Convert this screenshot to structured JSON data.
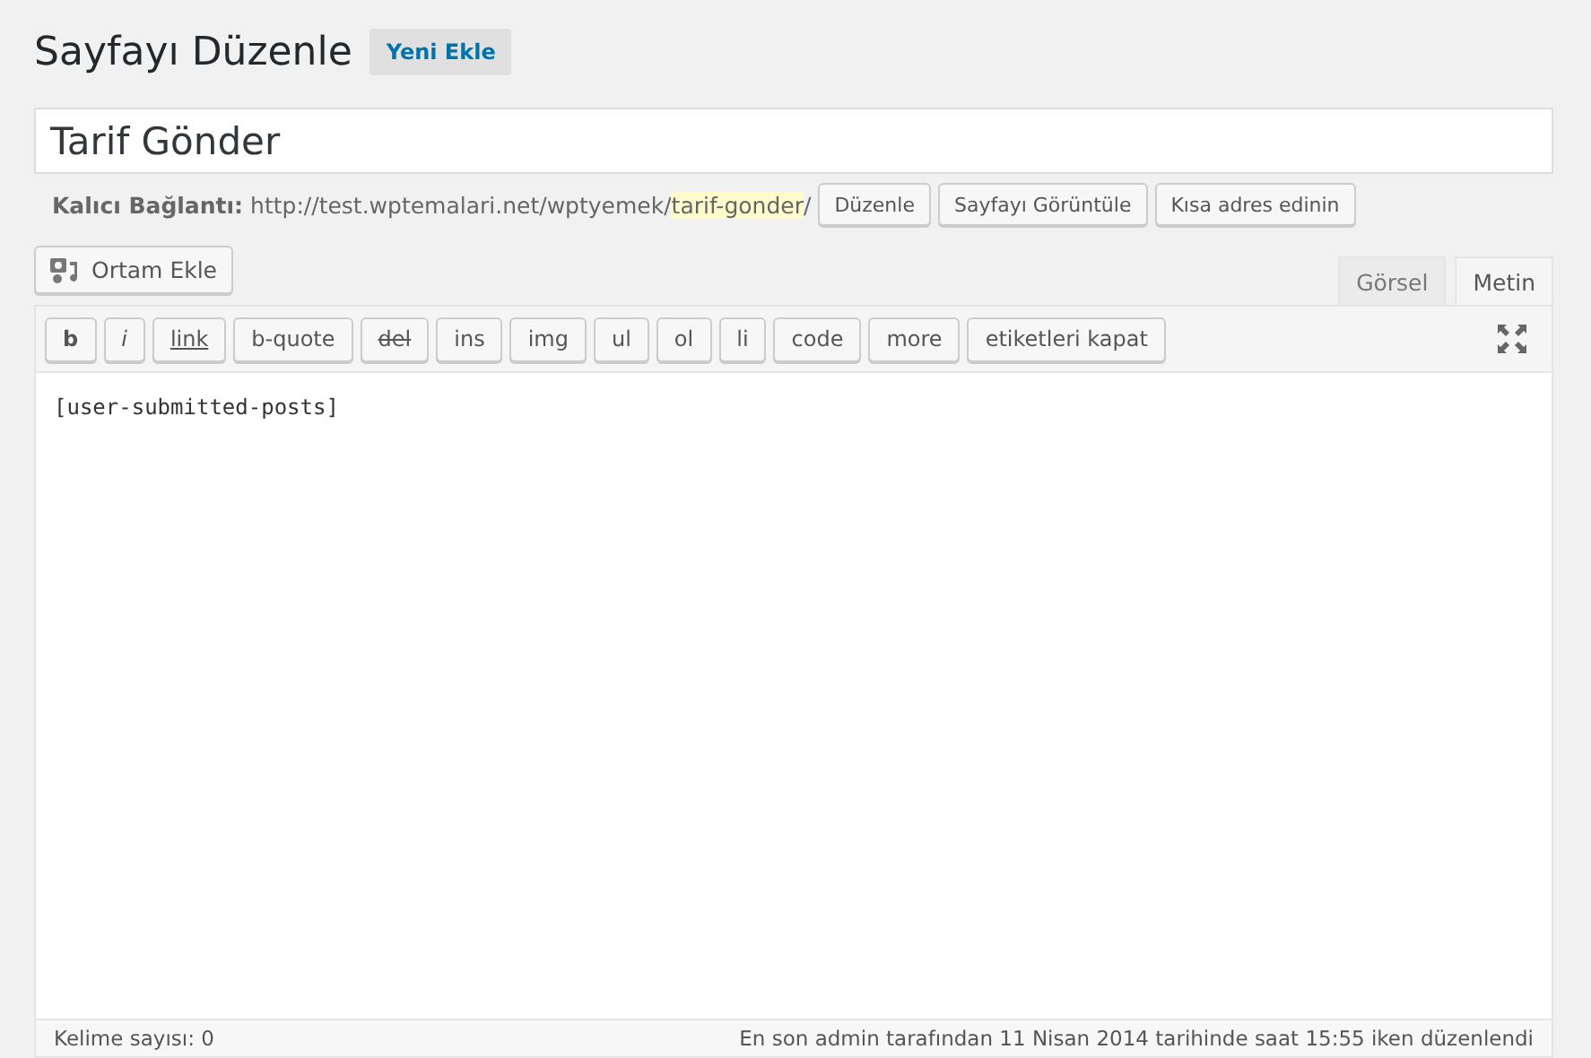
{
  "heading": {
    "title": "Sayfayı Düzenle",
    "add_new": "Yeni Ekle"
  },
  "title_field": {
    "value": "Tarif Gönder"
  },
  "permalink": {
    "label": "Kalıcı Bağlantı:",
    "base": "http://test.wptemalari.net/wptyemek/",
    "slug": "tarif-gonder",
    "trail": "/",
    "buttons": [
      "Düzenle",
      "Sayfayı Görüntüle",
      "Kısa adres edinin"
    ]
  },
  "media_button": "Ortam Ekle",
  "tabs": [
    {
      "label": "Görsel",
      "selected": false
    },
    {
      "label": "Metin",
      "selected": true
    }
  ],
  "quicktags": [
    {
      "label": "b",
      "kind": "bold"
    },
    {
      "label": "i",
      "kind": "italic"
    },
    {
      "label": "link",
      "kind": "underline"
    },
    {
      "label": "b-quote",
      "kind": "plain"
    },
    {
      "label": "del",
      "kind": "strike"
    },
    {
      "label": "ins",
      "kind": "plain"
    },
    {
      "label": "img",
      "kind": "plain"
    },
    {
      "label": "ul",
      "kind": "plain"
    },
    {
      "label": "ol",
      "kind": "plain"
    },
    {
      "label": "li",
      "kind": "plain"
    },
    {
      "label": "code",
      "kind": "plain"
    },
    {
      "label": "more",
      "kind": "plain"
    },
    {
      "label": "etiketleri kapat",
      "kind": "plain"
    }
  ],
  "editor": {
    "value": "[user-submitted-posts]"
  },
  "status_bar": {
    "word_count": "Kelime sayısı: 0",
    "last_edit": "En son admin tarafından 11 Nisan 2014 tarihinde saat 15:55 iken düzenlendi"
  }
}
